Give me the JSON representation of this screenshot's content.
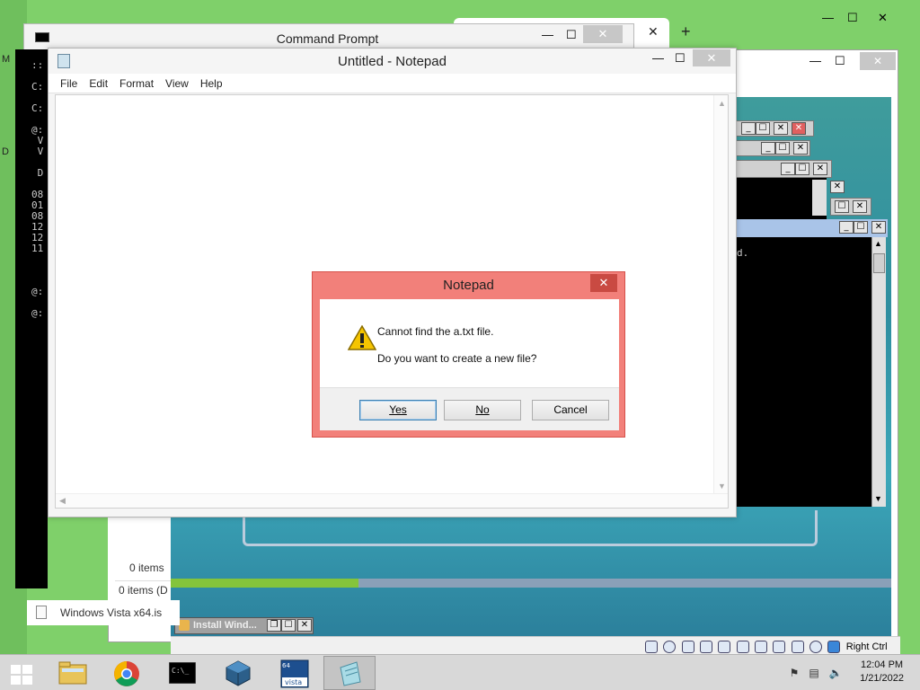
{
  "desktop": {
    "left_glyphs": [
      "M",
      "D"
    ]
  },
  "browser": {
    "new_tab_symbol": "+",
    "close_symbol": "✕"
  },
  "window_controls": {
    "minimize": "—",
    "maximize": "☐",
    "close": "✕"
  },
  "command_prompt": {
    "title": "Command Prompt",
    "console_lines": [
      "::",
      "",
      "C:",
      "",
      "C:",
      "",
      "@:",
      " V",
      " V",
      "",
      " D",
      "",
      "08",
      "01",
      "08",
      "12",
      "12",
      "11",
      "",
      "",
      "",
      "@:",
      "",
      "@:"
    ]
  },
  "explorer": {
    "items_count_1": "0 items",
    "items_count_2": "0 items (D",
    "file_name": "Windows Vista x64.is"
  },
  "vm": {
    "progress_fraction": 0.26,
    "status_label": "Right Ctrl",
    "guest_console_text": "d.",
    "install_window_title": "Install Wind..."
  },
  "notepad": {
    "title": "Untitled - Notepad",
    "menu": [
      "File",
      "Edit",
      "Format",
      "View",
      "Help"
    ],
    "content": ""
  },
  "dialog": {
    "title": "Notepad",
    "message_1": "Cannot find the a.txt file.",
    "message_2": "Do you want to create a new file?",
    "buttons": {
      "yes": "Yes",
      "no": "No",
      "cancel": "Cancel"
    }
  },
  "taskbar": {
    "time": "12:04 PM",
    "date": "1/21/2022",
    "apps": [
      "file-explorer",
      "chrome",
      "command-prompt",
      "virtualbox",
      "vista-64",
      "notepad"
    ]
  },
  "colors": {
    "desktop_green": "#7fd06a",
    "dialog_accent": "#f2807a",
    "dialog_close": "#c94a42",
    "vm_progress": "#84c43b"
  }
}
